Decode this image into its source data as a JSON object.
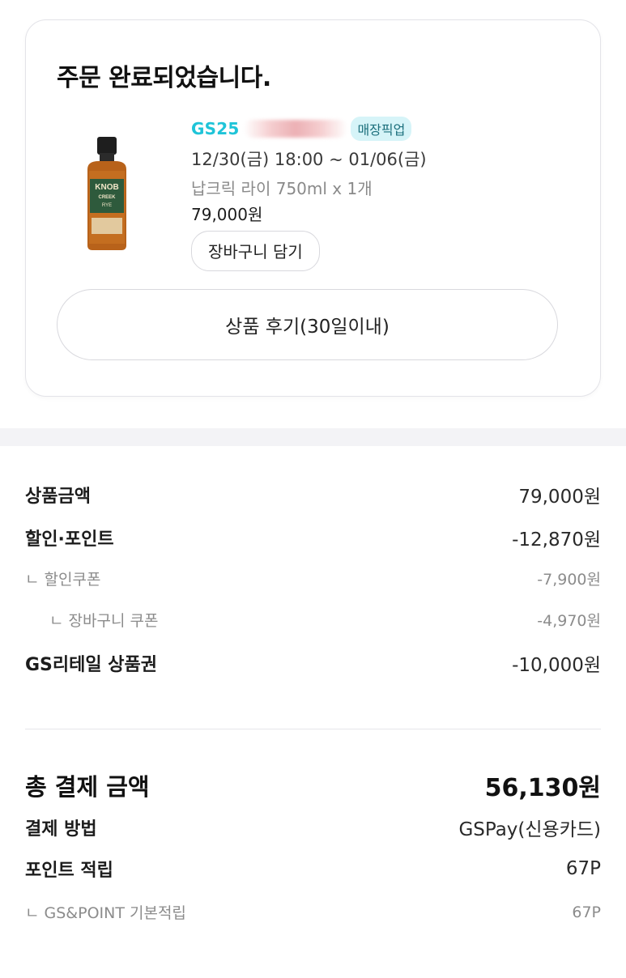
{
  "order": {
    "title": "주문 완료되었습니다.",
    "store_brand": "GS25",
    "pickup_badge": "매장픽업",
    "pickup_period": "12/30(금) 18:00 ~ 01/06(금)",
    "item_name": "납크릭 라이 750ml x 1개",
    "item_price": "79,000원",
    "cart_button": "장바구니 담기",
    "review_button": "상품 후기(30일이내)",
    "product_image": {
      "label_line1": "KNOB",
      "label_line2": "CREEK",
      "label_line3": "RYE"
    }
  },
  "summary": {
    "product_amount": {
      "label": "상품금액",
      "value": "79,000원"
    },
    "discount_points": {
      "label": "할인·포인트",
      "value": "-12,870원"
    },
    "discount_coupon": {
      "label": "ㄴ 할인쿠폰",
      "value": "-7,900원"
    },
    "cart_coupon": {
      "label": "ㄴ 장바구니 쿠폰",
      "value": "-4,970원"
    },
    "gift_card": {
      "label": "GS리테일 상품권",
      "value": "-10,000원"
    }
  },
  "payment": {
    "total": {
      "label": "총 결제 금액",
      "value": "56,130원"
    },
    "method": {
      "label": "결제 방법",
      "value": "GSPay(신용카드)"
    },
    "points": {
      "label": "포인트 적립",
      "value": "67P"
    },
    "points_basic": {
      "label": "ㄴ GS&POINT 기본적립",
      "value": "67P"
    }
  },
  "colors": {
    "brand": "#1fc4d8",
    "badge_bg": "#d6f4f8",
    "muted_text": "#8c8c8c",
    "band": "#f3f3f6"
  }
}
